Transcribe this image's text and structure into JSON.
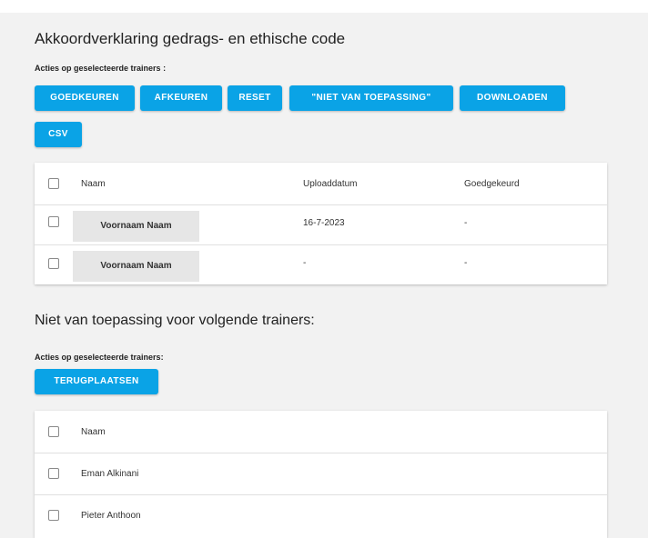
{
  "section1": {
    "title": "Akkoordverklaring gedrags- en ethische code",
    "actions_label": "Acties op geselecteerde trainers :",
    "buttons": {
      "approve": "GOEDKEUREN",
      "reject": "AFKEUREN",
      "reset": "RESET",
      "not_applicable": "\"NIET VAN TOEPASSING\"",
      "download": "DOWNLOADEN",
      "csv": "CSV"
    },
    "table": {
      "columns": [
        "Naam",
        "Uploaddatum",
        "Goedgekeurd"
      ],
      "rows": [
        {
          "name": "Voornaam Naam",
          "upload_date": "16-7-2023",
          "approved": "-"
        },
        {
          "name": "Voornaam Naam",
          "upload_date": "-",
          "approved": "-"
        }
      ]
    }
  },
  "section2": {
    "title": "Niet van toepassing voor volgende trainers:",
    "actions_label": "Acties op geselecteerde trainers:",
    "buttons": {
      "restore": "TERUGPLAATSEN"
    },
    "table": {
      "columns": [
        "Naam"
      ],
      "rows": [
        {
          "name": "Eman Alkinani"
        },
        {
          "name": "Pieter Anthoon"
        }
      ]
    }
  },
  "colors": {
    "accent": "#0aa3e6",
    "background": "#f2f2f2",
    "card": "#ffffff",
    "name_chip": "#e6e6e6"
  },
  "icons": {
    "checkbox": "checkbox-icon"
  }
}
